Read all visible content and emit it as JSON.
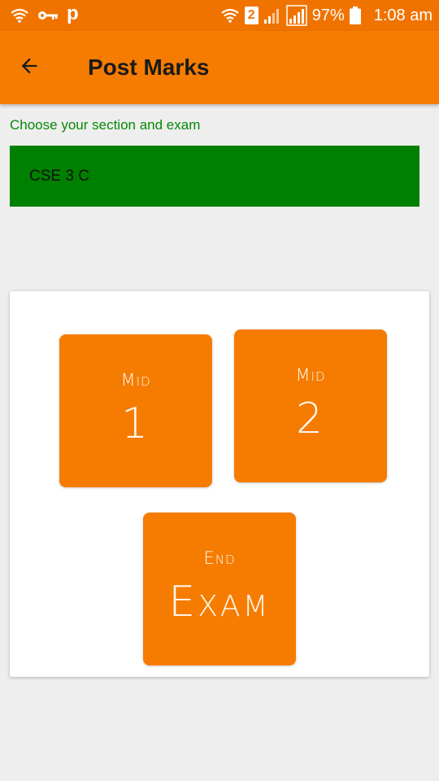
{
  "status_bar": {
    "battery_percent": "97%",
    "time": "1:08 am",
    "sim_slot": "2",
    "icons": [
      "wifi-calling-icon",
      "key-icon",
      "p-app-icon",
      "wifi-icon",
      "sim-2-icon",
      "signal-icon",
      "signal-icon",
      "battery-icon"
    ],
    "p_letter": "p"
  },
  "app_bar": {
    "title": "Post Marks",
    "back_icon": "arrow-back-icon"
  },
  "section": {
    "prompt": "Choose your section and exam",
    "selected": "CSE 3 C"
  },
  "exams": [
    {
      "top_label": "Mid",
      "main_label": "1"
    },
    {
      "top_label": "Mid",
      "main_label": "2"
    },
    {
      "top_label": "End",
      "main_label": "Exam"
    }
  ],
  "colors": {
    "status_bar": "#f07300",
    "app_bar": "#f57c00",
    "tile": "#f57c00",
    "section_bg": "#008000",
    "prompt_text": "#068a06",
    "background": "#eeeeee"
  }
}
